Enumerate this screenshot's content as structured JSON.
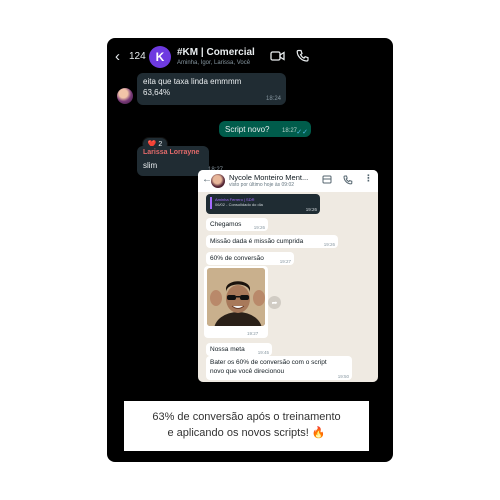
{
  "group_chat": {
    "back_count": "124",
    "avatar_letter": "K",
    "title": "#KM | Comercial",
    "subtitle": "Aminha, Igor, Larissa, Você",
    "messages": [
      {
        "text_line1": "eita que taxa linda emmmm",
        "text_line2": "63,64%",
        "time": "18:24",
        "reaction": "❤️",
        "reaction_count": "2"
      },
      {
        "text": "Script novo?",
        "time": "18:27"
      },
      {
        "sender": "Larissa Lorrayne",
        "text": "slim",
        "time": "18:27"
      }
    ],
    "sender_color": "#e26a6a"
  },
  "private_chat": {
    "contact_name": "Nycole Monteiro Ment...",
    "last_seen": "visto por último hoje às 09:02",
    "forward_title": "Aminha Ferrero | SDR",
    "forward_text": "06/02 - Consolidado do dia",
    "forward_time": "19:26",
    "messages": [
      {
        "text": "Chegamos",
        "time": "19:26"
      },
      {
        "text": "Missão dada é missão cumprida",
        "time": "19:26"
      },
      {
        "text": "60% de conversão",
        "time": "19:27"
      },
      {
        "image_time": "19:27"
      },
      {
        "text": "Nossa meta",
        "time": "19:45"
      },
      {
        "text_line1": "Bater os 60% de conversão com o script",
        "text_line2": "novo que você direcionou",
        "time": "19:50"
      }
    ]
  },
  "caption": {
    "line1": "63% de conversão após o treinamento",
    "line2": "e aplicando os novos scripts! 🔥"
  }
}
